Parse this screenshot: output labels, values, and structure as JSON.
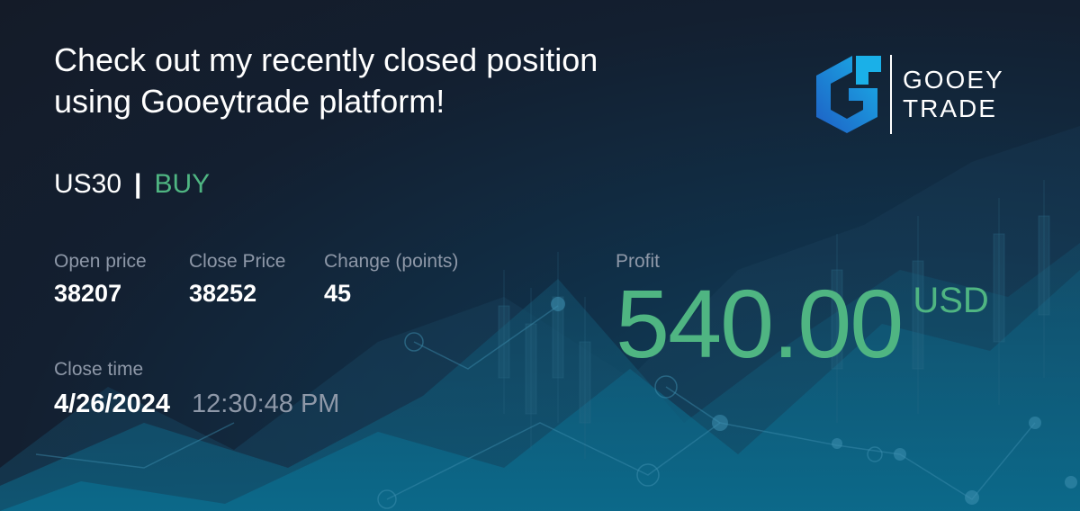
{
  "headline": {
    "line1": "Check out my recently closed position",
    "line2": "using Gooeytrade platform!"
  },
  "brand": {
    "logo_icon": "gooeytrade-logo-icon",
    "name_line1": "GOOEY",
    "name_line2": "TRADE",
    "logo_gradient": [
      "#1e6fd0",
      "#1ab0e8"
    ]
  },
  "position": {
    "instrument": "US30",
    "separator": "|",
    "side": "BUY"
  },
  "stats": {
    "open_price": {
      "label": "Open price",
      "value": "38207"
    },
    "close_price": {
      "label": "Close Price",
      "value": "38252"
    },
    "change": {
      "label": "Change (points)",
      "value": "45"
    }
  },
  "close_time": {
    "label": "Close time",
    "date": "4/26/2024",
    "time": "12:30:48 PM"
  },
  "profit": {
    "label": "Profit",
    "amount": "540.00",
    "currency": "USD"
  },
  "colors": {
    "accent_green": "#4fb582",
    "muted_text": "#8e98a8",
    "background": "#141b28"
  }
}
